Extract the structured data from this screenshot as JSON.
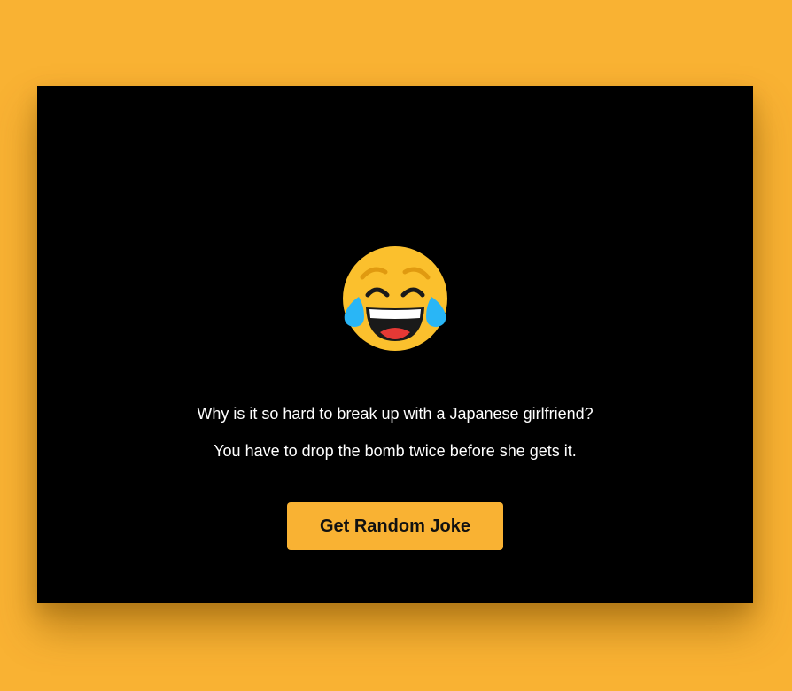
{
  "colors": {
    "page_background": "#f9b233",
    "card_background": "#000000",
    "button_background": "#f9b233",
    "text": "#ffffff"
  },
  "emoji": {
    "icon": "face-with-tears-of-joy-icon"
  },
  "joke": {
    "setup": "Why is it so hard to break up with a Japanese girlfriend?",
    "punchline": "You have to drop the bomb twice before she gets it."
  },
  "button": {
    "label": "Get Random Joke"
  }
}
